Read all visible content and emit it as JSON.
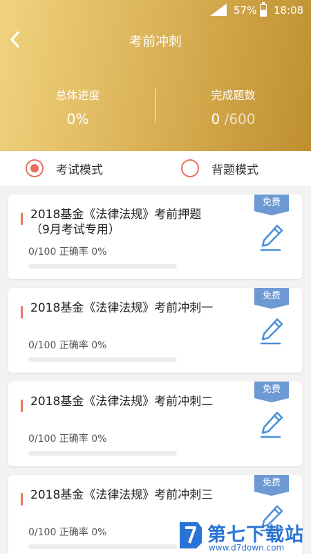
{
  "status_bar": {
    "network": "4G",
    "battery": "57%",
    "battery_level": 0.57,
    "time": "18:08"
  },
  "nav": {
    "back_icon": "chevron-left-icon",
    "title": "考前冲刺"
  },
  "stats": {
    "progress_label": "总体进度",
    "progress_value": "0%",
    "completed_label": "完成题数",
    "completed_count": "0",
    "completed_total": " /600"
  },
  "modes": {
    "exam": {
      "label": "考试模式",
      "selected": true
    },
    "memorize": {
      "label": "背题模式",
      "selected": false
    }
  },
  "papers": [
    {
      "title": "2018基金《法律法规》考前押题（9月考试专用）",
      "stats": "0/100 正确率 0%",
      "progress": 0,
      "badge": "免费"
    },
    {
      "title": "2018基金《法律法规》考前冲刺一",
      "stats": "0/100 正确率 0%",
      "progress": 0,
      "badge": "免费"
    },
    {
      "title": "2018基金《法律法规》考前冲刺二",
      "stats": "0/100 正确率 0%",
      "progress": 0,
      "badge": "免费"
    },
    {
      "title": "2018基金《法律法规》考前冲刺三",
      "stats": "0/100 正确率 0%",
      "progress": 0,
      "badge": "免费"
    }
  ],
  "watermark": {
    "title": "第七下载站",
    "url": "www.d7down.com"
  },
  "colors": {
    "accent": "#f0765e",
    "badge": "#6d9ad3",
    "edit_icon": "#4a90d9",
    "header_gradient_start": "#f1d37f",
    "header_gradient_end": "#bf8f2f"
  }
}
